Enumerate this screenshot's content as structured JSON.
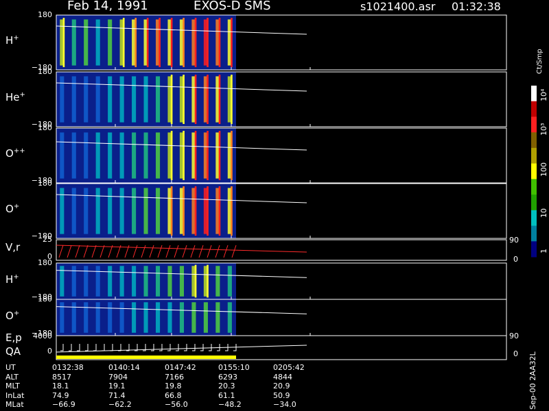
{
  "header": {
    "date": "Feb 14, 1991",
    "instrument": "EXOS-D SMS",
    "file": "s1021400.asr",
    "time": "01:32:38"
  },
  "colors": {
    "background": "#000000",
    "panel_fill": "#0a1f8a",
    "frame": "#ffffff",
    "trace": "#ffffff",
    "velocity_trace": "#ff2a2a",
    "qa_bar": "#ffff00"
  },
  "chart_data": {
    "type": "heatmap",
    "x_ticks": [
      "0132:38",
      "0140:14",
      "0147:42",
      "0155:10",
      "0205:42"
    ],
    "data_end_tick_fraction": 0.33,
    "panels": [
      {
        "id": "h-plus",
        "label_main": "H",
        "label_sup": "+",
        "y_top": "180",
        "y_bottom": "−180",
        "intensity": [
          0.6,
          0.4,
          0.5,
          0.3,
          0.5,
          0.6,
          0.7,
          0.8,
          0.9,
          0.8,
          0.7,
          0.9,
          1.0,
          0.9,
          0.8
        ],
        "trace_start": 0.8,
        "trace_end": 0.65
      },
      {
        "id": "he-plus",
        "label_main": "He",
        "label_sup": "+",
        "y_top": "180",
        "y_bottom": "−180",
        "intensity": [
          0.1,
          0.1,
          0.1,
          0.1,
          0.2,
          0.3,
          0.3,
          0.3,
          0.4,
          0.6,
          0.6,
          0.8,
          0.9,
          0.8,
          0.6
        ],
        "trace_start": 0.8,
        "trace_end": 0.65
      },
      {
        "id": "o-plus-plus",
        "label_main": "O",
        "label_sup": "++",
        "y_top": "180",
        "y_bottom": "−180",
        "intensity": [
          0.1,
          0.1,
          0.1,
          0.2,
          0.3,
          0.3,
          0.4,
          0.4,
          0.5,
          0.6,
          0.6,
          0.8,
          0.9,
          0.8,
          0.7
        ],
        "trace_start": 0.75,
        "trace_end": 0.6
      },
      {
        "id": "o-plus",
        "label_main": "O",
        "label_sup": "+",
        "y_top": "180",
        "y_bottom": "−180",
        "intensity": [
          0.2,
          0.1,
          0.1,
          0.2,
          0.3,
          0.3,
          0.4,
          0.5,
          0.5,
          0.7,
          0.7,
          0.9,
          1.0,
          0.9,
          0.7
        ],
        "trace_start": 0.8,
        "trace_end": 0.65
      }
    ],
    "velocity_panel": {
      "label": "V,r",
      "y_top": "25",
      "y_bottom": "0",
      "right_top": "90",
      "right_bottom": "0"
    },
    "lower_panels": [
      {
        "id": "h-plus-2",
        "label_main": "H",
        "label_sup": "+",
        "y_top": "180",
        "y_bottom": "−180",
        "intensity": [
          0.3,
          0.1,
          0.1,
          0.1,
          0.2,
          0.2,
          0.3,
          0.4,
          0.4,
          0.5,
          0.5,
          0.6,
          0.6,
          0.5,
          0.4
        ],
        "trace_start": 0.8,
        "trace_end": 0.6
      },
      {
        "id": "o-plus-2",
        "label_main": "O",
        "label_sup": "+",
        "y_top": "180",
        "y_bottom": "−180",
        "intensity": [
          0.1,
          0.1,
          0.1,
          0.1,
          0.1,
          0.1,
          0.2,
          0.2,
          0.2,
          0.3,
          0.4,
          0.5,
          0.5,
          0.5,
          0.4
        ],
        "trace_start": 0.8,
        "trace_end": 0.6
      }
    ],
    "ep_panel": {
      "label1": "E,p",
      "label2": "QA",
      "y_top": "4000",
      "y_bottom": "0",
      "right_top": "90",
      "right_bottom": "0"
    },
    "colorbar": {
      "unit": "Ct/Smp",
      "labels": [
        "10⁴",
        "10³",
        "100",
        "10",
        "1"
      ],
      "stops": [
        "#ffffff",
        "#c00000",
        "#ff2020",
        "#806000",
        "#b0a000",
        "#ffff00",
        "#40c000",
        "#20a000",
        "#00c0c0",
        "#0080a0",
        "#000080"
      ]
    }
  },
  "orbit_table": {
    "rows": [
      {
        "label": "UT",
        "values": [
          "0132:38",
          "0140:14",
          "0147:42",
          "0155:10",
          "0205:42"
        ]
      },
      {
        "label": "ALT",
        "values": [
          "8517",
          "7904",
          "7166",
          "6293",
          "4844"
        ]
      },
      {
        "label": "MLT",
        "values": [
          "18.1",
          "19.1",
          "19.8",
          "20.3",
          "20.9"
        ]
      },
      {
        "label": "InLat",
        "values": [
          "74.9",
          "71.4",
          "66.8",
          "61.1",
          "50.9"
        ]
      },
      {
        "label": "MLat",
        "values": [
          "−66.9",
          "−62.2",
          "−56.0",
          "−48.2",
          "−34.0"
        ]
      }
    ]
  },
  "footer": {
    "tag": "Sep-00  2AA32L"
  }
}
